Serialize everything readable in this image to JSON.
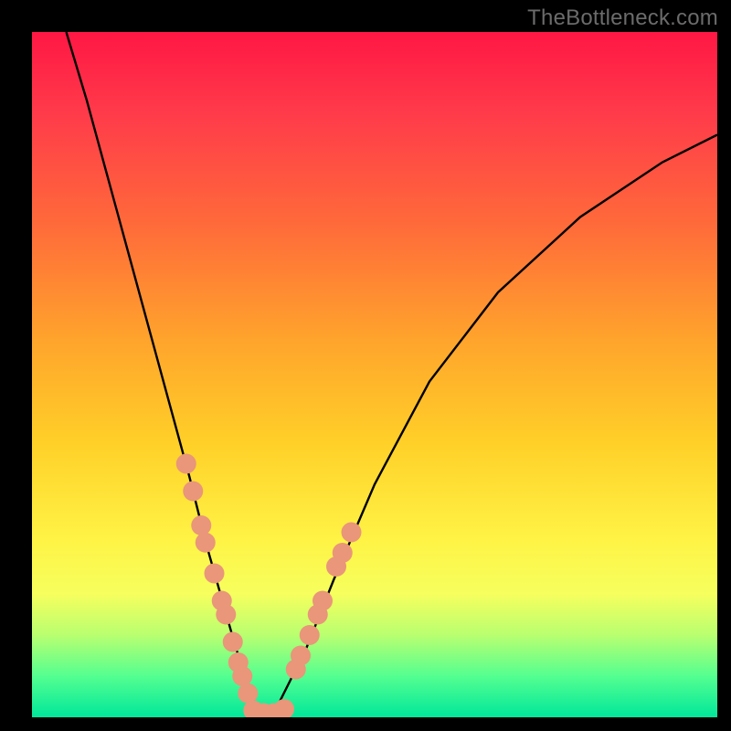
{
  "watermark": "TheBottleneck.com",
  "chart_data": {
    "type": "line",
    "title": "",
    "xlabel": "",
    "ylabel": "",
    "xlim": [
      0,
      100
    ],
    "ylim": [
      0,
      100
    ],
    "grid": false,
    "legend": false,
    "curve": {
      "name": "bottleneck-curve",
      "x": [
        5,
        8,
        11,
        14,
        17,
        20,
        23,
        25.5,
        27.5,
        29.5,
        31,
        32.5,
        34,
        35,
        36,
        40,
        44,
        50,
        58,
        68,
        80,
        92,
        100
      ],
      "y": [
        100,
        90,
        79,
        68,
        57,
        46,
        35,
        25,
        18,
        11,
        6,
        2,
        0,
        0,
        2,
        10,
        20,
        34,
        49,
        62,
        73,
        81,
        85
      ]
    },
    "dots_left": {
      "name": "left-branch-markers",
      "color": "#e9967a",
      "radius": 11,
      "x": [
        22.5,
        23.5,
        24.7,
        25.3,
        26.6,
        27.7,
        28.3,
        29.3,
        30.1,
        30.7,
        31.5
      ],
      "y": [
        37,
        33,
        28,
        25.5,
        21,
        17,
        15,
        11,
        8,
        6,
        3.5
      ]
    },
    "dots_right": {
      "name": "right-branch-markers",
      "color": "#e9967a",
      "radius": 11,
      "x": [
        38.5,
        39.2,
        40.5,
        41.7,
        42.4,
        44.4,
        45.3,
        46.6
      ],
      "y": [
        7,
        9,
        12,
        15,
        17,
        22,
        24,
        27
      ]
    },
    "dots_bottom": {
      "name": "trough-markers",
      "color": "#e9967a",
      "radius": 11,
      "x": [
        32.3,
        33.8,
        35.3,
        36.8
      ],
      "y": [
        1.0,
        0.6,
        0.6,
        1.2
      ]
    }
  }
}
